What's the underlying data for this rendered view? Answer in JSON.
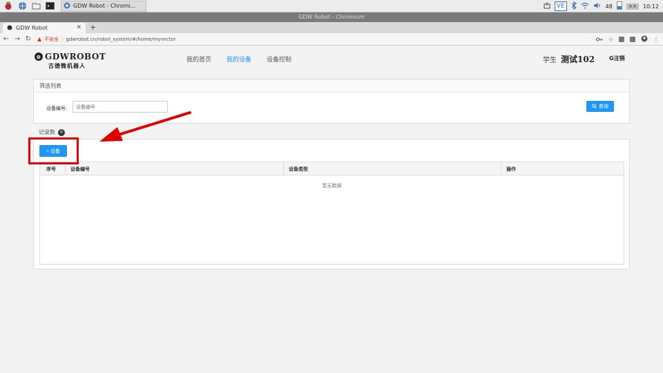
{
  "taskbar": {
    "window_title": "GDW Robot - Chromi...",
    "tray": {
      "vc_label": "VE",
      "volume": "48",
      "keyboard": "A A",
      "time": "10:12"
    },
    "icons": [
      "raspberry-icon",
      "globe-icon",
      "folder-icon",
      "terminal-icon"
    ]
  },
  "window": {
    "title": "GDW Robot - Chromium"
  },
  "browser": {
    "tab_title": "GDW Robot",
    "new_tab": "+",
    "insecure_label": "不安全",
    "url": "gdwrobot.cn/robot_system/#/home/myvector",
    "separator": "|"
  },
  "header": {
    "logo_text": "GDWROBOT",
    "logo_sub": "古德微机器人",
    "nav": [
      "我的首页",
      "我的设备",
      "设备控制"
    ],
    "active_nav": 1,
    "user_role": "学生",
    "user_name": "测试102",
    "logout_label": "G注销"
  },
  "filter": {
    "title": "筛选列表",
    "label": "设备编号:",
    "placeholder": "设备编号",
    "search_label": "查询"
  },
  "records": {
    "label": "记录数",
    "count": "0",
    "add_label": "+ 设备"
  },
  "table": {
    "columns": [
      "序号",
      "设备编号",
      "设备类型",
      "操作"
    ],
    "empty_text": "暂无数据"
  },
  "colors": {
    "accent": "#2196f3",
    "highlight": "#e00000"
  }
}
